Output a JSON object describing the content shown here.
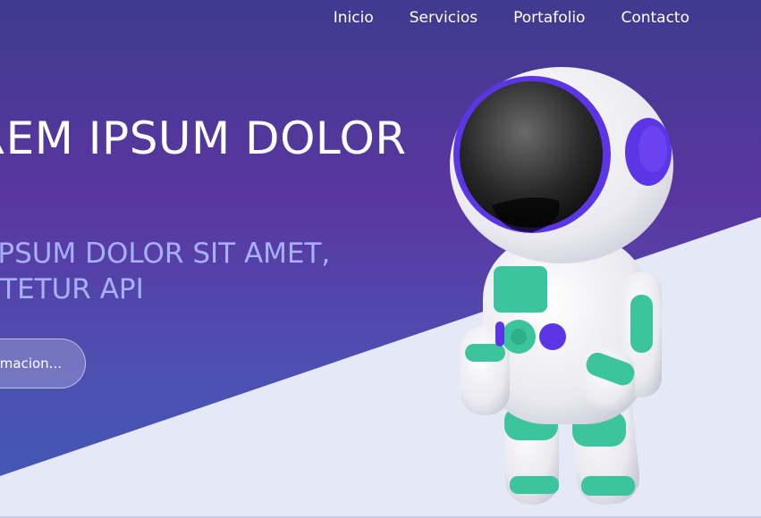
{
  "nav": {
    "items": [
      {
        "label": "Inicio"
      },
      {
        "label": "Servicios"
      },
      {
        "label": "Portafolio"
      },
      {
        "label": "Contacto"
      }
    ]
  },
  "hero": {
    "title": "LOREM IPSUM DOLOR",
    "subtitle_line1": "LOREM IPSUM DOLOR SIT AMET,",
    "subtitle_line2": "CONSECTETUR API",
    "cta_label": "Mas informacion..."
  },
  "colors": {
    "gradient_top": "#3f3b8f",
    "gradient_mid": "#5a36a0",
    "gradient_bottom": "#3f5ab8",
    "light_panel": "#e4e8f7",
    "subtitle": "#a7b0ff",
    "astronaut_accent_purple": "#5b35e6",
    "astronaut_accent_teal": "#3cc49e"
  }
}
